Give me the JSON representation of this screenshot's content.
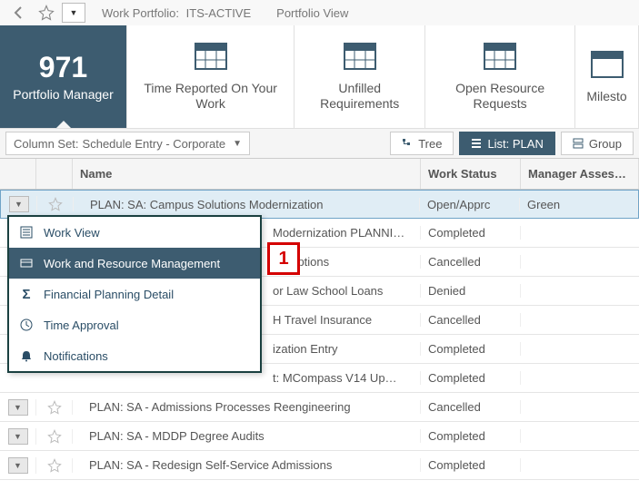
{
  "toolbar": {
    "work_portfolio_label": "Work Portfolio:",
    "work_portfolio_value": "ITS-ACTIVE",
    "portfolio_view": "Portfolio View"
  },
  "tiles": [
    {
      "count": "971",
      "label": "Portfolio Manager",
      "active": true
    },
    {
      "label": "Time Reported On Your Work"
    },
    {
      "label": "Unfilled Requirements"
    },
    {
      "label": "Open Resource Requests"
    },
    {
      "label": "Milesto"
    }
  ],
  "column_set": {
    "prefix": "Column Set:",
    "value": "Schedule Entry - Corporate"
  },
  "view_buttons": {
    "tree": "Tree",
    "list": "List: PLAN",
    "group": "Group"
  },
  "columns": {
    "name": "Name",
    "status": "Work Status",
    "assess": "Manager Asses…"
  },
  "rows": [
    {
      "name": "PLAN: SA: Campus Solutions Modernization",
      "status": "Open/Apprc",
      "assess": "Green",
      "selected": true
    },
    {
      "name": "Modernization PLANNI…",
      "status": "Completed",
      "assess": ""
    },
    {
      "name": "escriptions",
      "status": "Cancelled",
      "assess": ""
    },
    {
      "name": "or Law School Loans",
      "status": "Denied",
      "assess": ""
    },
    {
      "name": "H Travel Insurance",
      "status": "Cancelled",
      "assess": ""
    },
    {
      "name": "ization Entry",
      "status": "Completed",
      "assess": ""
    },
    {
      "name": "t: MCompass V14 Up…",
      "status": "Completed",
      "assess": ""
    },
    {
      "name": "PLAN: SA - Admissions Processes Reengineering",
      "status": "Cancelled",
      "assess": ""
    },
    {
      "name": "PLAN: SA - MDDP Degree Audits",
      "status": "Completed",
      "assess": ""
    },
    {
      "name": "PLAN: SA - Redesign Self-Service Admissions",
      "status": "Completed",
      "assess": ""
    }
  ],
  "context_menu": {
    "items": [
      {
        "label": "Work View",
        "icon": "list-icon"
      },
      {
        "label": "Work and Resource Management",
        "icon": "card-icon",
        "active": true
      },
      {
        "label": "Financial Planning Detail",
        "icon": "sigma-icon"
      },
      {
        "label": "Time Approval",
        "icon": "clock-icon"
      },
      {
        "label": "Notifications",
        "icon": "bell-icon"
      }
    ]
  },
  "callout": {
    "label": "1"
  }
}
